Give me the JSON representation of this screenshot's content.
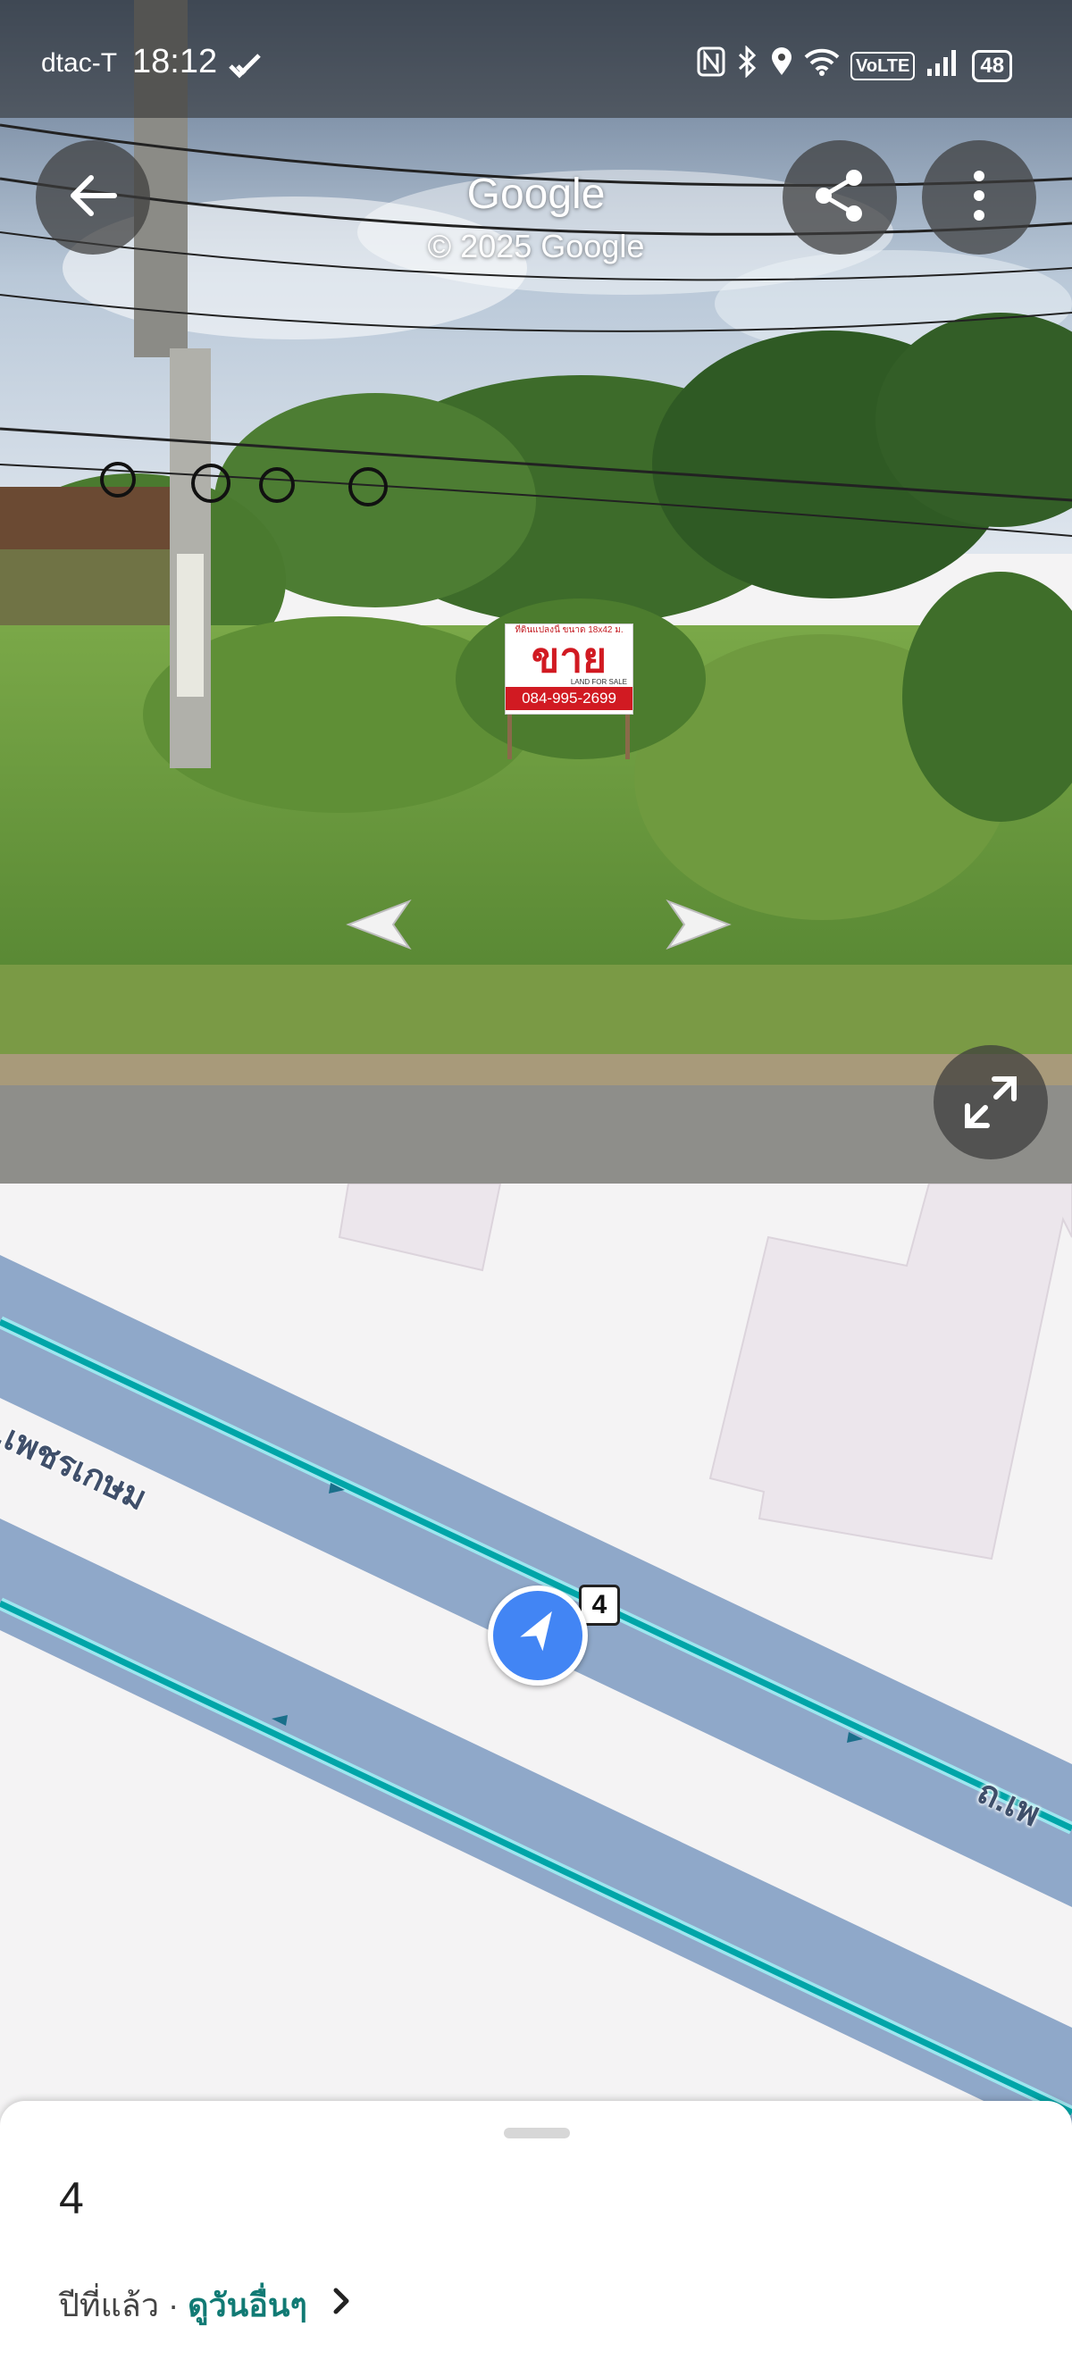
{
  "status_bar": {
    "carrier": "dtac-T",
    "time": "18:12",
    "volte": "VoLTE",
    "battery": "48",
    "icons": [
      "nfc-icon",
      "bluetooth-icon",
      "location-icon",
      "wifi-icon",
      "volte-icon",
      "signal-icon",
      "battery-icon"
    ]
  },
  "header": {
    "title": "Google",
    "copyright": "© 2025 Google",
    "buttons": [
      "back-arrow-icon",
      "share-icon",
      "more-vert-icon"
    ]
  },
  "street_view": {
    "sign": {
      "top_line": "ที่ดินแปลงนี้ ขนาด 18x42 ม.",
      "main": "ขาย",
      "sub": "LAND FOR SALE",
      "phone": "084-995-2699"
    },
    "nav_arrows": [
      "nav-arrow-left-icon",
      "nav-arrow-right-icon"
    ],
    "fullscreen_icon": "expand-icon"
  },
  "map": {
    "road_label_1": "ถ.เพชรเกษม",
    "road_label_2": "ถ.เพ",
    "route_shield": "4",
    "colors": {
      "road": "#8fa8c9",
      "center_line": "#00a5a8",
      "location_dot": "#4285f4",
      "building": "#ece6ec"
    }
  },
  "sheet": {
    "title": "4",
    "sub_prefix": "ปีที่แล้ว · ",
    "sub_link": "ดูวันอื่นๆ",
    "chevron": "chevron-right-icon"
  }
}
